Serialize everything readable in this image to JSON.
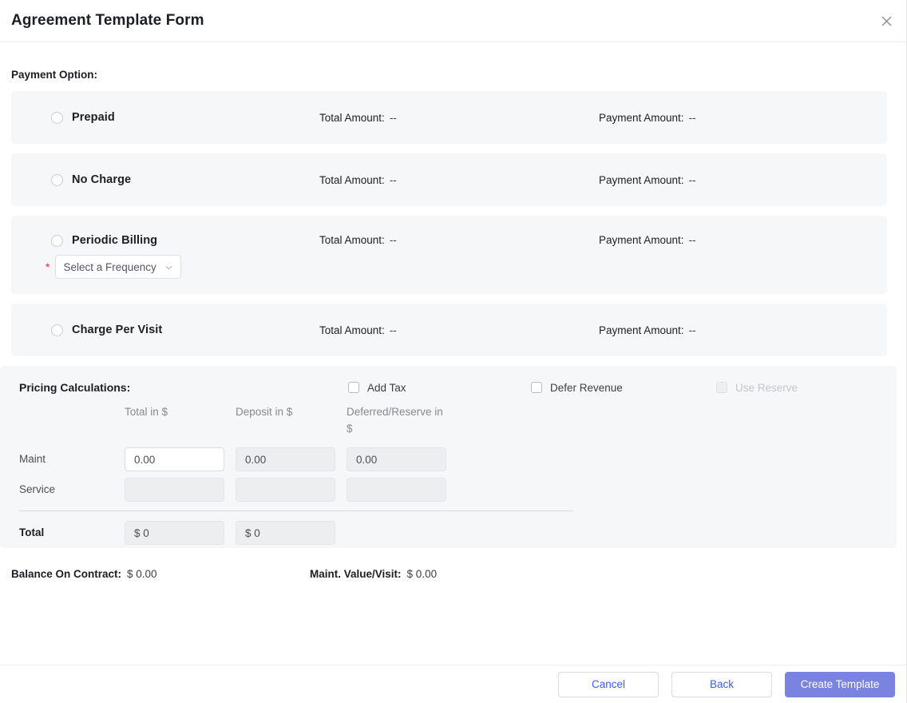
{
  "header": {
    "title": "Agreement Template Form",
    "close_icon": "close-icon"
  },
  "body": {
    "payment_option_label": "Payment Option:",
    "options": [
      {
        "name": "Prepaid",
        "total_amount_label": "Total Amount:",
        "total_amount_value": "--",
        "payment_amount_label": "Payment Amount:",
        "payment_amount_value": "--",
        "selected": false
      },
      {
        "name": "No Charge",
        "total_amount_label": "Total Amount:",
        "total_amount_value": "--",
        "payment_amount_label": "Payment Amount:",
        "payment_amount_value": "--",
        "selected": false
      },
      {
        "name": "Periodic Billing",
        "total_amount_label": "Total Amount:",
        "total_amount_value": "--",
        "payment_amount_label": "Payment Amount:",
        "payment_amount_value": "--",
        "selected": false,
        "frequency_required_marker": "*",
        "frequency_placeholder": "Select a Frequency",
        "frequency_chevron_icon": "chevron-down-icon"
      },
      {
        "name": "Charge Per Visit",
        "total_amount_label": "Total Amount:",
        "total_amount_value": "--",
        "payment_amount_label": "Payment Amount:",
        "payment_amount_value": "--",
        "selected": false
      }
    ],
    "pricing": {
      "title": "Pricing Calculations:",
      "checkboxes": [
        {
          "label": "Add Tax",
          "checked": false,
          "disabled": false
        },
        {
          "label": "Defer Revenue",
          "checked": false,
          "disabled": false
        },
        {
          "label": "Use Reserve",
          "checked": false,
          "disabled": true
        }
      ],
      "columns": [
        "Total in $",
        "Deposit in $",
        "Deferred/Reserve in $"
      ],
      "rows": [
        {
          "label": "Maint",
          "cells": [
            {
              "value": "0.00",
              "active": true
            },
            {
              "value": "0.00",
              "active": false
            },
            {
              "value": "0.00",
              "active": false
            }
          ]
        },
        {
          "label": "Service",
          "cells": [
            {
              "value": "",
              "active": false
            },
            {
              "value": "",
              "active": false
            },
            {
              "value": "",
              "active": false
            }
          ]
        }
      ],
      "total_row": {
        "label": "Total",
        "cells": [
          {
            "value": "$ 0"
          },
          {
            "value": "$ 0"
          }
        ]
      }
    },
    "summary": [
      {
        "key": "Balance On Contract:",
        "value": "$ 0.00"
      },
      {
        "key": "Maint. Value/Visit:",
        "value": "$ 0.00"
      }
    ]
  },
  "footer": {
    "cancel_label": "Cancel",
    "back_label": "Back",
    "create_label": "Create Template"
  },
  "colors": {
    "primary_button": "#7b83e0",
    "link_text": "#3b5bfd",
    "required_star": "#e0224c",
    "panel_background": "#f6f7f8"
  }
}
